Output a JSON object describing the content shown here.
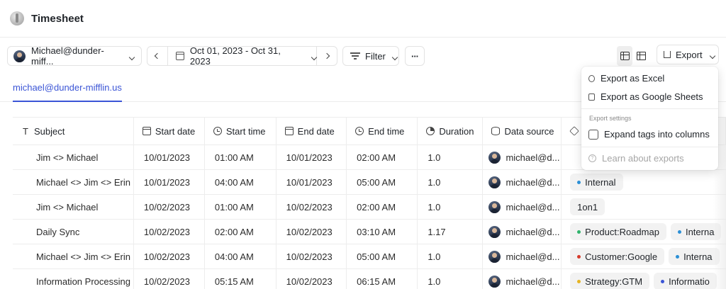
{
  "app": {
    "title": "Timesheet"
  },
  "toolbar": {
    "user_label": "Michael@dunder-miff...",
    "date_range": "Oct 01, 2023 - Oct 31, 2023",
    "filter_label": "Filter",
    "more_label": "···",
    "export_label": "Export"
  },
  "tabs": [
    {
      "label": "michael@dunder-mifflin.us",
      "active": true
    }
  ],
  "table": {
    "columns": [
      {
        "label": "Subject",
        "icon": "text-icon"
      },
      {
        "label": "Start date",
        "icon": "calendar-icon"
      },
      {
        "label": "Start time",
        "icon": "clock-icon"
      },
      {
        "label": "End date",
        "icon": "calendar-icon"
      },
      {
        "label": "End time",
        "icon": "clock-icon"
      },
      {
        "label": "Duration",
        "icon": "duration-icon"
      },
      {
        "label": "Data source",
        "icon": "database-icon"
      }
    ],
    "rows": [
      {
        "subject": "Jim <> Michael",
        "start_date": "10/01/2023",
        "start_time": "01:00 AM",
        "end_date": "10/01/2023",
        "end_time": "02:00 AM",
        "duration": "1.0",
        "source": "michael@d...",
        "tags": []
      },
      {
        "subject": "Michael <> Jim <> Erin",
        "start_date": "10/01/2023",
        "start_time": "04:00 AM",
        "end_date": "10/01/2023",
        "end_time": "05:00 AM",
        "duration": "1.0",
        "source": "michael@d...",
        "tags": [
          {
            "label": "Internal",
            "color": "#2b8fd6"
          }
        ]
      },
      {
        "subject": "Jim <> Michael",
        "start_date": "10/02/2023",
        "start_time": "01:00 AM",
        "end_date": "10/02/2023",
        "end_time": "02:00 AM",
        "duration": "1.0",
        "source": "michael@d...",
        "tags": [
          {
            "label": "1on1",
            "color": ""
          }
        ]
      },
      {
        "subject": "Daily Sync",
        "start_date": "10/02/2023",
        "start_time": "02:00 AM",
        "end_date": "10/02/2023",
        "end_time": "03:10 AM",
        "duration": "1.17",
        "source": "michael@d...",
        "tags": [
          {
            "label": "Product:Roadmap",
            "color": "#2fb36b"
          },
          {
            "label": "Interna",
            "color": "#2b8fd6"
          }
        ]
      },
      {
        "subject": "Michael <> Jim <> Erin",
        "start_date": "10/02/2023",
        "start_time": "04:00 AM",
        "end_date": "10/02/2023",
        "end_time": "05:00 AM",
        "duration": "1.0",
        "source": "michael@d...",
        "tags": [
          {
            "label": "Customer:Google",
            "color": "#d63a2b"
          },
          {
            "label": "Interna",
            "color": "#2b8fd6"
          }
        ]
      },
      {
        "subject": "Information Processing",
        "start_date": "10/02/2023",
        "start_time": "05:15 AM",
        "end_date": "10/02/2023",
        "end_time": "06:15 AM",
        "duration": "1.0",
        "source": "michael@d...",
        "tags": [
          {
            "label": "Strategy:GTM",
            "color": "#e6b422"
          },
          {
            "label": "Informatio",
            "color": "#3b55d6"
          }
        ]
      }
    ]
  },
  "export_menu": {
    "excel": "Export as Excel",
    "sheets": "Export as Google Sheets",
    "settings_caption": "Export settings",
    "expand_tags": "Expand tags into columns",
    "learn": "Learn about exports"
  }
}
